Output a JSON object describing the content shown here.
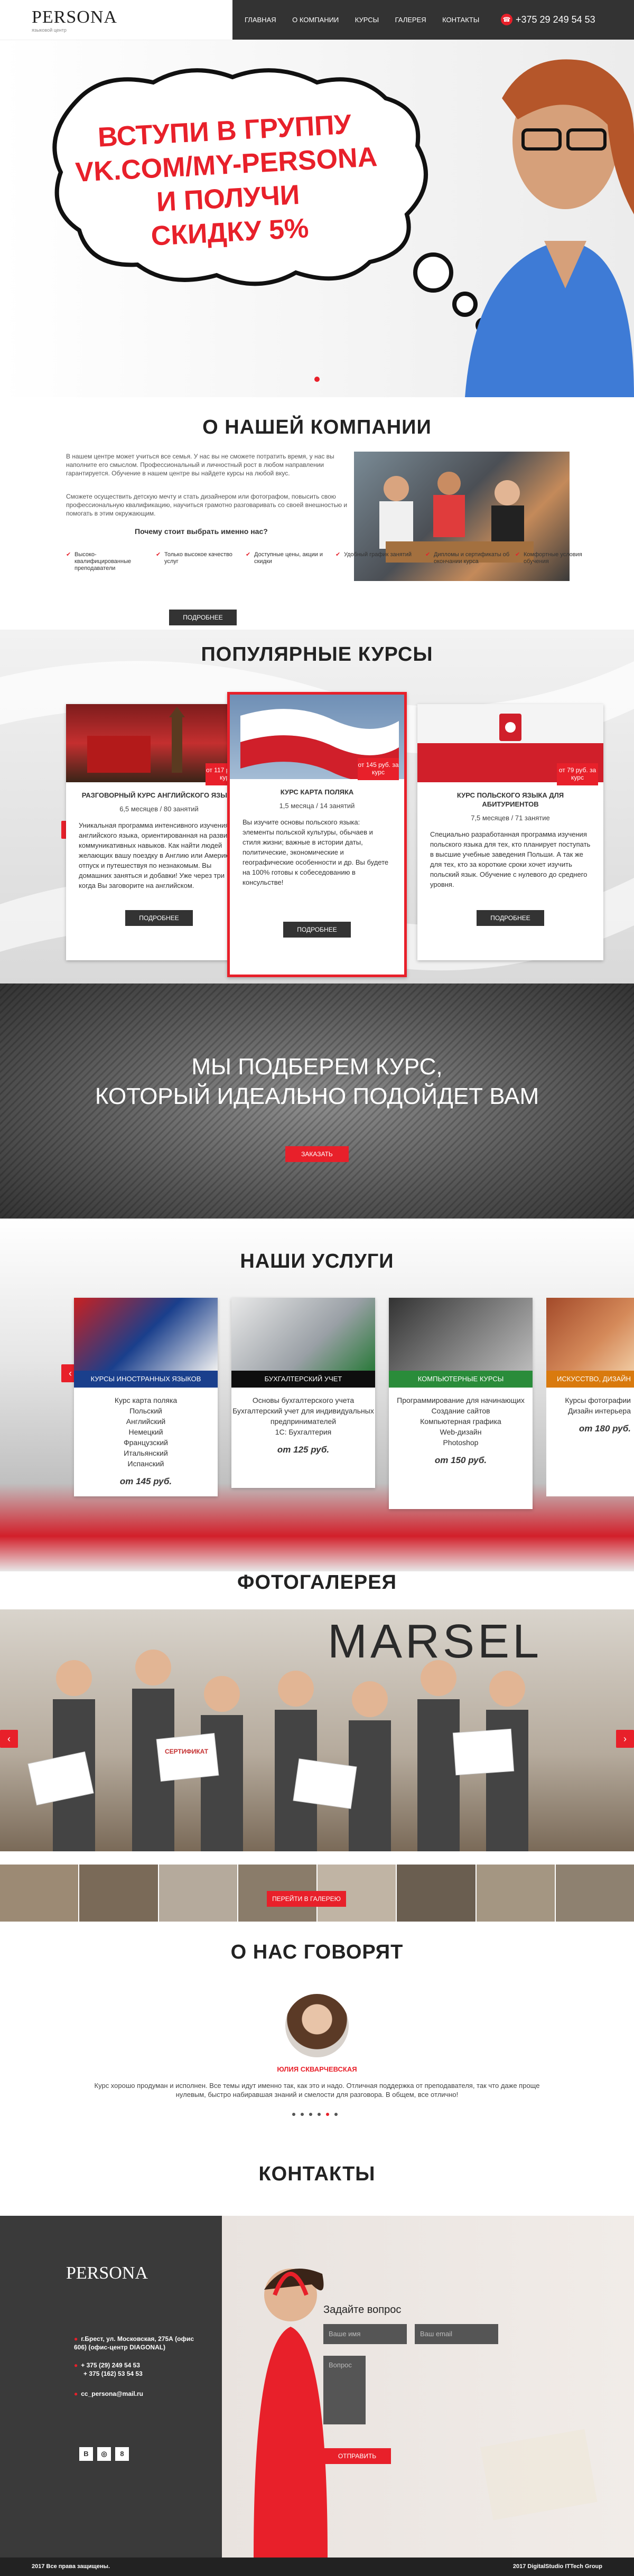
{
  "header": {
    "logo": "PERSONA",
    "logo_sub": "языковой центр",
    "nav": [
      "ГЛАВНАЯ",
      "О КОМПАНИИ",
      "КУРСЫ",
      "ГАЛЕРЕЯ",
      "КОНТАКТЫ"
    ],
    "phone": "+375 29 249 54 53"
  },
  "hero": {
    "bubble_lines": [
      "ВСТУПИ В ГРУППУ",
      "VK.COM/MY-PERSONA",
      "И ПОЛУЧИ",
      "СКИДКУ 5%"
    ]
  },
  "about": {
    "title": "О НАШЕЙ КОМПАНИИ",
    "para1": "В нашем центре может учиться все семья. У нас вы не сможете потратить время, у нас вы наполните его смыслом. Профессиональный и личностный рост в любом направлении гарантируется. Обучение в нашем центре вы найдете курсы на любой вкус.",
    "para2": "Сможете осуществить детскую мечту и стать дизайнером или фотографом, повысить свою профессиональную квалификацию, научиться грамотно разговаривать со своей внешностью и помогать в этим окружающим.",
    "why_title": "Почему стоит выбрать именно нас?",
    "features": [
      "Высоко-квалифицированные преподаватели",
      "Только высокое качество услуг",
      "Доступные цены, акции и скидки",
      "Удобный график занятий",
      "Дипломы и сертификаты об окончании курса",
      "Комфортные условия обучения"
    ],
    "more": "ПОДРОБНЕЕ"
  },
  "courses": {
    "title": "ПОПУЛЯРНЫЕ КУРСЫ",
    "more": "ПОДРОБНЕЕ",
    "items": [
      {
        "price": "от 117 руб. за курс",
        "title": "РАЗГОВОРНЫЙ КУРС АНГЛИЙСКОГО ЯЗЫКА",
        "sub": "6,5 месяцев / 80 занятий",
        "text": "Уникальная программа интенсивного изучения английского языка, ориентированная на развитие коммуникативных навыков. Как найти людей желающих вашу поездку в Англию или Америку в отпуск и путешествуя по незнакомым. Вы домашних заняться и добавки! Уже через три когда Вы заговорите на английском."
      },
      {
        "price": "от 145 руб. за курс",
        "title": "КУРС КАРТА ПОЛЯКА",
        "sub": "1,5 месяца / 14 занятий",
        "text": "Вы изучите основы польского языка: элементы польской культуры, обычаев и стиля жизни; важные в истории даты, политические, экономические и географические особенности и др. Вы будете на 100% готовы к собеседованию в консульстве!"
      },
      {
        "price": "от 79 руб. за курс",
        "title": "КУРС ПОЛЬСКОГО ЯЗЫКА ДЛЯ АБИТУРИЕНТОВ",
        "sub": "7,5 месяцев / 71 занятие",
        "text": "Специально разработанная программа изучения польского языка для тех, кто планирует поступать в высшие учебные заведения Польши. А так же для тех, кто за короткие сроки хочет изучить польский язык. Обучение с нулевого до среднего уровня."
      }
    ]
  },
  "promo": {
    "line1": "МЫ ПОДБЕРЕМ КУРС,",
    "line2": "КОТОРЫЙ ИДЕАЛЬНО ПОДОЙДЕТ ВАМ",
    "button": "ЗАКАЗАТЬ"
  },
  "services": {
    "title": "НАШИ УСЛУГИ",
    "items": [
      {
        "label": "КУРСЫ ИНОСТРАННЫХ ЯЗЫКОВ",
        "color": "#1a3f8c",
        "list": [
          "Курс карта поляка",
          "Польский",
          "Английский",
          "Немецкий",
          "Французский",
          "Итальянский",
          "Испанский"
        ],
        "price": "от 145 руб."
      },
      {
        "label": "БУХГАЛТЕРСКИЙ УЧЕТ",
        "color": "#0e0e0e",
        "list": [
          "Основы бухгалтерского учета",
          "Бухгалтерский учет для индивидуальных предпринимателей",
          "1С: Бухгалтерия"
        ],
        "price": "от 125 руб."
      },
      {
        "label": "КОМПЬЮТЕРНЫЕ КУРСЫ",
        "color": "#2a8c3a",
        "list": [
          "Программирование для начинающих",
          "Создание сайтов",
          "Компьютерная графика",
          "Web-дизайн",
          "Photoshop"
        ],
        "price": "от 150 руб."
      },
      {
        "label": "ИСКУССТВО, ДИЗАЙН",
        "color": "#d97a0e",
        "list": [
          "Курсы фотографии",
          "Дизайн интерьера"
        ],
        "price": "от 180 руб."
      }
    ]
  },
  "gallery": {
    "title": "ФОТОГАЛЕРЕЯ",
    "button": "ПЕРЕЙТИ В ГАЛЕРЕЮ",
    "banner": "MARSEL",
    "cert": "СЕРТИФИКАТ"
  },
  "reviews": {
    "title": "О НАС ГОВОРЯТ",
    "name": "ЮЛИЯ СКВАРЧЕВСКАЯ",
    "text": "Курс хорошо продуман и исполнен. Все темы идут именно так, как это и надо. Отличная поддержка от преподавателя, так что даже проще нулевым, быстро набиравшая знаний и смелости для разговора. В общем, все отлично!"
  },
  "contacts": {
    "title": "КОНТАКТЫ",
    "logo": "PERSONA",
    "address": "г.Брест, ул. Московская, 275А (офис 606) (офис-центр DIAGONAL)",
    "phone1": "+ 375 (29) 249 54 53",
    "phone2": "+ 375 (162) 53 54 53",
    "email": "cc_persona@mail.ru",
    "form_title": "Задайте вопрос",
    "name_placeholder": "Ваше имя",
    "email_placeholder": "Ваш email",
    "question_placeholder": "Вопрос",
    "submit": "ОТПРАВИТЬ",
    "social": [
      "В",
      "◎",
      "8"
    ]
  },
  "footer": {
    "copyright": "2017 Все права защищены.",
    "dev": "2017 DigitalStudio ITTech Group"
  },
  "colors": {
    "accent": "#e8202a",
    "dark": "#333333"
  }
}
